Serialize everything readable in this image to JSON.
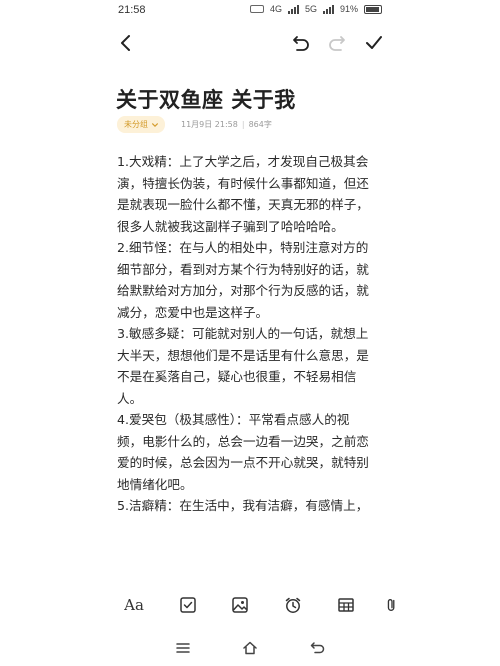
{
  "status_bar": {
    "time": "21:58",
    "network_1": "4G",
    "network_2": "5G",
    "battery": "91%"
  },
  "toolbar": {
    "back_icon": "chevron-left",
    "undo_icon": "undo",
    "redo_icon": "redo",
    "done_icon": "check"
  },
  "note": {
    "title": "关于双鱼座  关于我",
    "category_tag": "未分组",
    "date": "11月9日 21:58",
    "separator": "|",
    "char_count": "864字",
    "lines": [
      "1.大戏精：上了大学之后，才发现自己极其会",
      "演，特擅长伪装，有时候什么事都知道，但还",
      "是就表现一脸什么都不懂，天真无邪的样子，",
      "很多人就被我这副样子骗到了哈哈哈哈。",
      "2.细节怪：在与人的相处中，特别注意对方的",
      "细节部分，看到对方某个行为特别好的话，就",
      "给默默给对方加分，对那个行为反感的话，就",
      "减分，恋爱中也是这样子。",
      "3.敏感多疑：可能就对别人的一句话，就想上",
      "大半天，想想他们是不是话里有什么意思，是",
      "不是在奚落自己，疑心也很重，不轻易相信",
      "人。",
      "4.爱哭包（极其感性）：平常看点感人的视",
      "频，电影什么的，总会一边看一边哭，之前恋",
      "爱的时候，总会因为一点不开心就哭，就特别",
      "地情绪化吧。",
      "5.洁癖精：在生活中，我有洁癖，有感情上，"
    ]
  },
  "edit_toolbar": {
    "text_format_label": "Aa",
    "icons": [
      "text-format",
      "checkbox",
      "image",
      "alarm-clock",
      "table",
      "attachment"
    ]
  },
  "nav_bar": {
    "icons": [
      "menu",
      "home",
      "back"
    ]
  }
}
